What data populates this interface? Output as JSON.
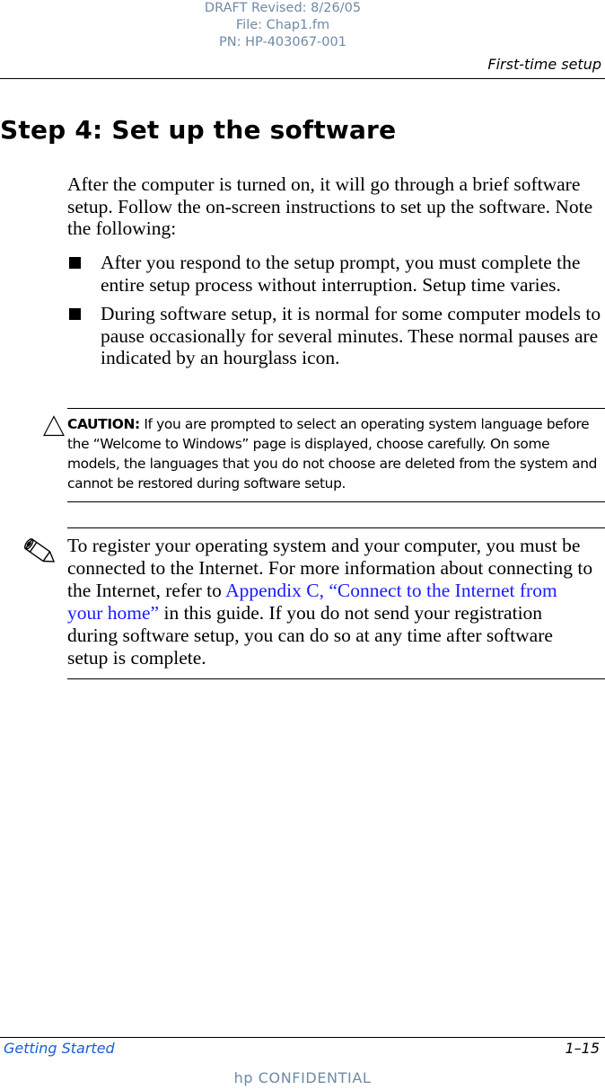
{
  "draft_stamp": {
    "line1": "DRAFT Revised: 8/26/05",
    "line2": "File: Chap1.fm",
    "line3": "PN: HP-403067-001"
  },
  "header": {
    "running_title": "First-time setup"
  },
  "section": {
    "title": "Step 4: Set up the software",
    "intro": "After the computer is turned on, it will go through a brief software setup. Follow the on-screen instructions to set up the software. Note the following:",
    "bullets": [
      {
        "icon": "square-bullet-icon",
        "text": "After you respond to the setup prompt, you must complete the entire setup process without interruption. Setup time varies."
      },
      {
        "icon": "square-bullet-icon",
        "text": "During software setup, it is normal for some computer models to pause occasionally for several minutes. These normal pauses are indicated by an hourglass icon."
      }
    ]
  },
  "caution": {
    "icon": "warning-triangle-icon",
    "label": "CAUTION:",
    "text": " If you are prompted to select an operating system language before the “Welcome to Windows” page is displayed, choose carefully. On some models, the languages that you do not choose are deleted from the system and cannot be restored during software setup."
  },
  "note": {
    "icon": "pencil-note-icon",
    "text_before": "To register your operating system and your computer, you must be connected to the Internet. For more information about connecting to the Internet, refer to ",
    "link_text": "Appendix C, “Connect to the Internet from your home”",
    "text_after": " in this guide. If you do not send your registration during software setup, you can do so at any time after software setup is complete."
  },
  "footer": {
    "book_title": "Getting Started",
    "page_number": "1–15",
    "confidential": "hp CONFIDENTIAL"
  },
  "colors": {
    "draft_text": "#6f8aa5",
    "link": "#1a1aff",
    "footer_title": "#1a5fd6"
  }
}
